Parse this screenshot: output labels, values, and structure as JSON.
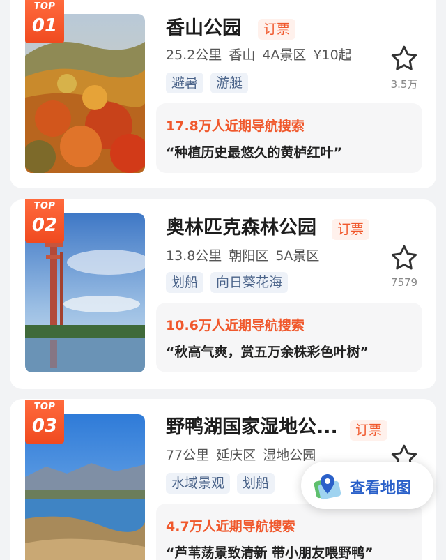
{
  "cards": [
    {
      "rank_top": "TOP",
      "rank_num": "01",
      "title": "香山公园",
      "book_label": "订票",
      "meta": [
        "25.2公里",
        "香山",
        "4A景区",
        "¥10起"
      ],
      "tags": [
        "避暑",
        "游艇"
      ],
      "fav_count": "3.5万",
      "hot_text": "17.8万人近期导航搜索",
      "quote": "“种植历史最悠久的黄栌红叶”"
    },
    {
      "rank_top": "TOP",
      "rank_num": "02",
      "title": "奥林匹克森林公园",
      "book_label": "订票",
      "meta": [
        "13.8公里",
        "朝阳区",
        "5A景区"
      ],
      "tags": [
        "划船",
        "向日葵花海"
      ],
      "fav_count": "7579",
      "hot_text": "10.6万人近期导航搜索",
      "quote": "“秋高气爽，赏五万余株彩色叶树”"
    },
    {
      "rank_top": "TOP",
      "rank_num": "03",
      "title": "野鸭湖国家湿地公...",
      "book_label": "订票",
      "meta": [
        "77公里",
        "延庆区",
        "湿地公园"
      ],
      "tags": [
        "水域景观",
        "划船"
      ],
      "fav_count": "",
      "hot_text": "4.7万人近期导航搜索",
      "quote": "“芦苇荡景致清新 带小朋友喂野鸭”"
    }
  ],
  "map_button": {
    "label": "查看地图",
    "icon": "map-pin-icon"
  },
  "icons": {
    "favorite": "star-outline-icon"
  },
  "colors": {
    "accent": "#f0582c",
    "tag_text": "#4a6389",
    "map_blue": "#2a60c9"
  }
}
